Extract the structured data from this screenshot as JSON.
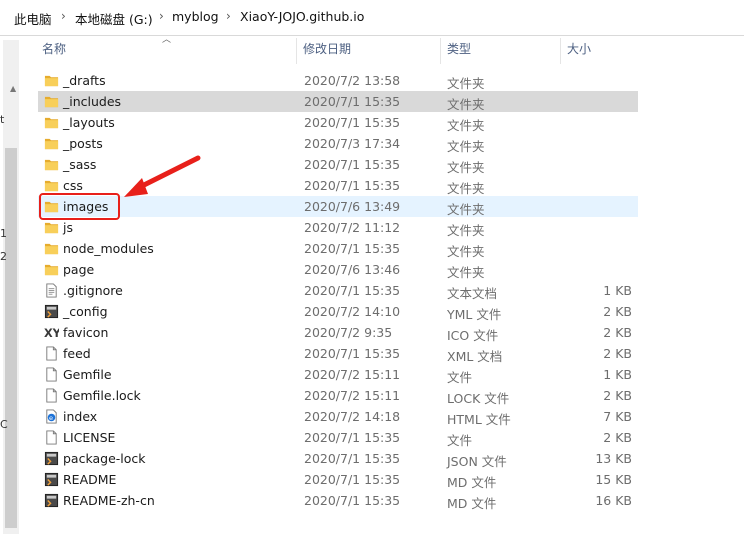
{
  "breadcrumb": {
    "items": [
      "此电脑",
      "本地磁盘 (G:)",
      "myblog",
      "XiaoY-JOJO.github.io"
    ],
    "separator": "›"
  },
  "nav_pane": {
    "clipped_glyphs": [
      "t",
      "1",
      "2",
      "C"
    ]
  },
  "columns": {
    "name": "名称",
    "date": "修改日期",
    "type": "类型",
    "size": "大小"
  },
  "files": [
    {
      "name": "_drafts",
      "date": "2020/7/2 13:58",
      "type": "文件夹",
      "size": "",
      "icon": "folder-icon"
    },
    {
      "name": "_includes",
      "date": "2020/7/1 15:35",
      "type": "文件夹",
      "size": "",
      "icon": "folder-icon"
    },
    {
      "name": "_layouts",
      "date": "2020/7/1 15:35",
      "type": "文件夹",
      "size": "",
      "icon": "folder-icon"
    },
    {
      "name": "_posts",
      "date": "2020/7/3 17:34",
      "type": "文件夹",
      "size": "",
      "icon": "folder-icon"
    },
    {
      "name": "_sass",
      "date": "2020/7/1 15:35",
      "type": "文件夹",
      "size": "",
      "icon": "folder-icon"
    },
    {
      "name": "css",
      "date": "2020/7/1 15:35",
      "type": "文件夹",
      "size": "",
      "icon": "folder-icon"
    },
    {
      "name": "images",
      "date": "2020/7/6 13:49",
      "type": "文件夹",
      "size": "",
      "icon": "folder-icon"
    },
    {
      "name": "js",
      "date": "2020/7/2 11:12",
      "type": "文件夹",
      "size": "",
      "icon": "folder-icon"
    },
    {
      "name": "node_modules",
      "date": "2020/7/1 15:35",
      "type": "文件夹",
      "size": "",
      "icon": "folder-icon"
    },
    {
      "name": "page",
      "date": "2020/7/6 13:46",
      "type": "文件夹",
      "size": "",
      "icon": "folder-icon"
    },
    {
      "name": ".gitignore",
      "date": "2020/7/1 15:35",
      "type": "文本文档",
      "size": "1 KB",
      "icon": "text-file-icon"
    },
    {
      "name": "_config",
      "date": "2020/7/2 14:10",
      "type": "YML 文件",
      "size": "2 KB",
      "icon": "editor-file-icon"
    },
    {
      "name": "favicon",
      "date": "2020/7/2 9:35",
      "type": "ICO 文件",
      "size": "2 KB",
      "icon": "ico-file-icon"
    },
    {
      "name": "feed",
      "date": "2020/7/1 15:35",
      "type": "XML 文档",
      "size": "2 KB",
      "icon": "blank-file-icon"
    },
    {
      "name": "Gemfile",
      "date": "2020/7/2 15:11",
      "type": "文件",
      "size": "1 KB",
      "icon": "blank-file-icon"
    },
    {
      "name": "Gemfile.lock",
      "date": "2020/7/2 15:11",
      "type": "LOCK 文件",
      "size": "2 KB",
      "icon": "blank-file-icon"
    },
    {
      "name": "index",
      "date": "2020/7/2 14:18",
      "type": "HTML 文件",
      "size": "7 KB",
      "icon": "edge-html-icon"
    },
    {
      "name": "LICENSE",
      "date": "2020/7/1 15:35",
      "type": "文件",
      "size": "2 KB",
      "icon": "blank-file-icon"
    },
    {
      "name": "package-lock",
      "date": "2020/7/1 15:35",
      "type": "JSON 文件",
      "size": "13 KB",
      "icon": "editor-file-icon"
    },
    {
      "name": "README",
      "date": "2020/7/1 15:35",
      "type": "MD 文件",
      "size": "15 KB",
      "icon": "editor-file-icon"
    },
    {
      "name": "README-zh-cn",
      "date": "2020/7/1 15:35",
      "type": "MD 文件",
      "size": "16 KB",
      "icon": "editor-file-icon"
    }
  ],
  "selected_row": "_includes",
  "hovered_row": "images",
  "annotation": {
    "target": "images",
    "color": "#e8201a"
  },
  "colors": {
    "selected_bg": "#d9d9d9",
    "hover_bg": "#e5f3ff",
    "folder": "#f5c24c",
    "header_text": "#4d6082"
  }
}
